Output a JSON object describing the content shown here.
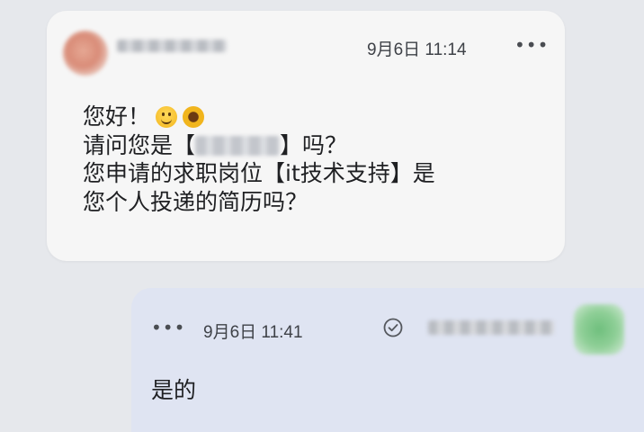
{
  "incoming": {
    "timestamp": "9月6日 11:14",
    "more_label": "•••",
    "line1": "您好！",
    "line2_before": "请问您是【",
    "line2_after": "】吗？",
    "line3": "您申请的求职岗位【it技术支持】是",
    "line4": "您个人投递的简历吗？",
    "emojis": [
      "smiling-face",
      "sunflower"
    ]
  },
  "outgoing": {
    "timestamp": "9月6日 11:41",
    "more_label": "•••",
    "text": "是的",
    "status_icon": "check-circle-icon"
  },
  "colors": {
    "background": "#e6e8ec",
    "incoming_bubble": "#f6f6f6",
    "outgoing_bubble": "#dfe4f2"
  }
}
